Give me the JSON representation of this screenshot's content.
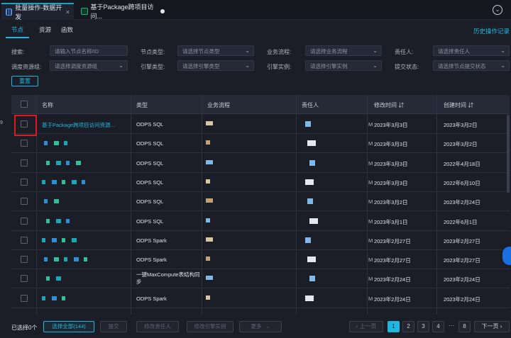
{
  "tabs": [
    {
      "label": "批量操作-数据开发",
      "close": "×"
    },
    {
      "label": "基于Package跨项目访问..."
    }
  ],
  "collapse_icon": "chevron-down-icon",
  "subtabs": [
    "节点",
    "资源",
    "函数"
  ],
  "history_link": "历史操作记录",
  "filters": {
    "search_label": "搜索:",
    "search_placeholder": "请输入节点名称/ID",
    "node_type_label": "节点类型:",
    "node_type_placeholder": "请选择节点类型",
    "business_flow_label": "业务流程:",
    "business_flow_placeholder": "请选择业务流程",
    "owner_label": "责任人:",
    "owner_placeholder": "请选择责任人",
    "resource_group_label": "调度资源组:",
    "resource_group_placeholder": "请选择调度资源组",
    "engine_type_label": "引擎类型:",
    "engine_type_placeholder": "请选择引擎类型",
    "engine_instance_label": "引擎实例:",
    "engine_instance_placeholder": "请选择引擎实例",
    "submit_status_label": "提交状态:",
    "submit_status_placeholder": "请选择节点提交状态",
    "reset": "重置"
  },
  "table": {
    "headers": {
      "name": "名称",
      "type": "类型",
      "flow": "业务流程",
      "owner": "责任人",
      "modified": "修改时间 ⇵",
      "created": "创建时间 ⇵"
    },
    "rows": [
      {
        "name": "基于Package跨项目访问资源...",
        "type": "ODPS SQL",
        "modified": "2023年3月3日",
        "created": "2023年3月2日"
      },
      {
        "name": "",
        "type": "ODPS SQL",
        "modified": "2023年3月3日",
        "created": "2023年3月2日"
      },
      {
        "name": "",
        "type": "ODPS SQL",
        "modified": "2023年3月3日",
        "created": "2022年4月18日"
      },
      {
        "name": "",
        "type": "ODPS SQL",
        "modified": "2023年3月3日",
        "created": "2022年6月10日"
      },
      {
        "name": "",
        "type": "ODPS SQL",
        "modified": "2023年3月2日",
        "created": "2023年2月24日"
      },
      {
        "name": "",
        "type": "ODPS SQL",
        "modified": "2023年3月1日",
        "created": "2022年6月1日"
      },
      {
        "name": "",
        "type": "ODPS Spark",
        "modified": "2023年2月27日",
        "created": "2023年2月27日"
      },
      {
        "name": "",
        "type": "ODPS Spark",
        "modified": "2023年2月27日",
        "created": "2023年2月27日"
      },
      {
        "name": "",
        "type": "一键MaxCompute表结构同步",
        "modified": "2023年2月24日",
        "created": "2023年2月24日"
      },
      {
        "name": "",
        "type": "ODPS Spark",
        "modified": "2023年2月24日",
        "created": "2023年2月24日"
      }
    ]
  },
  "footer": {
    "selected": "已选择0个",
    "select_all": "选择全部(144)",
    "submit": "提交",
    "change_owner": "修改责任人",
    "change_engine": "修改引擎实例",
    "more": "更多",
    "prev": "上一页",
    "pages": [
      "1",
      "2",
      "3",
      "4",
      "···",
      "8"
    ],
    "next": "下一页"
  },
  "colors": {
    "accent": "#1fb6e0",
    "highlight_box": "#e0191b",
    "background": "#1b1e27"
  }
}
